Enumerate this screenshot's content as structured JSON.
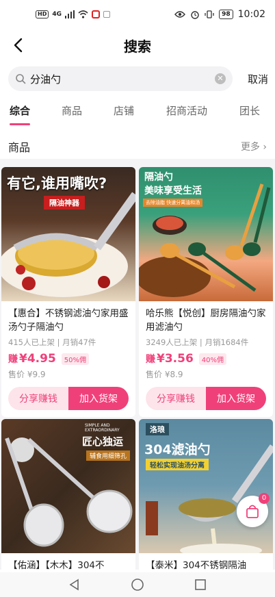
{
  "status_bar": {
    "sim1": "HD",
    "network": "4G",
    "battery": "98",
    "time": "10:02"
  },
  "header": {
    "title": "搜索"
  },
  "search": {
    "value": "分油勺",
    "cancel_label": "取消"
  },
  "tabs": [
    {
      "label": "综合",
      "active": true
    },
    {
      "label": "商品",
      "active": false
    },
    {
      "label": "店铺",
      "active": false
    },
    {
      "label": "招商活动",
      "active": false
    },
    {
      "label": "团长",
      "active": false
    }
  ],
  "section": {
    "title": "商品",
    "more_label": "更多"
  },
  "products": [
    {
      "image_text_main": "有它,谁用嘴吹?",
      "image_text_badge": "隔油神器",
      "title": "【惠合】不锈钢滤油勺家用盛汤勺子隔油勺",
      "meta": "415人已上架 | 月销47件",
      "earn_label": "赚",
      "earn_price": "¥4.95",
      "commission": "50%佣",
      "sale_price": "售价 ¥9.9",
      "share_label": "分享赚钱",
      "add_label": "加入货架"
    },
    {
      "image_text_main": "隔油勺",
      "image_text_sub": "美味享受生活",
      "image_text_badge": "去除油脂 快速分离油和汤",
      "title": "哈乐熊【悦创】厨房隔油勺家用滤油勺",
      "meta": "3249人已上架 | 月销1684件",
      "earn_label": "赚",
      "earn_price": "¥3.56",
      "commission": "40%佣",
      "sale_price": "售价 ¥8.9",
      "share_label": "分享赚钱",
      "add_label": "加入货架"
    },
    {
      "image_text_main": "匠心独运",
      "image_text_sub": "SIMPLE AND EXTRAORDINARY",
      "image_text_badge": "辅食用细筛孔",
      "title": "【佑涵】【木木】304不",
      "meta": "",
      "earn_label": "",
      "earn_price": "",
      "commission": "",
      "sale_price": "",
      "share_label": "",
      "add_label": ""
    },
    {
      "image_text_brand": "洛琅",
      "image_text_main": "304滤油勺",
      "image_text_badge": "轻松实现油汤分离",
      "title": "【泰米】304不锈钢隔油",
      "meta": "",
      "earn_label": "",
      "earn_price": "",
      "commission": "",
      "sale_price": "",
      "share_label": "",
      "add_label": ""
    }
  ],
  "cart": {
    "count": "0"
  },
  "colors": {
    "accent": "#f0407a",
    "accent_light": "#fde4ea",
    "background": "#f4f4f6"
  }
}
